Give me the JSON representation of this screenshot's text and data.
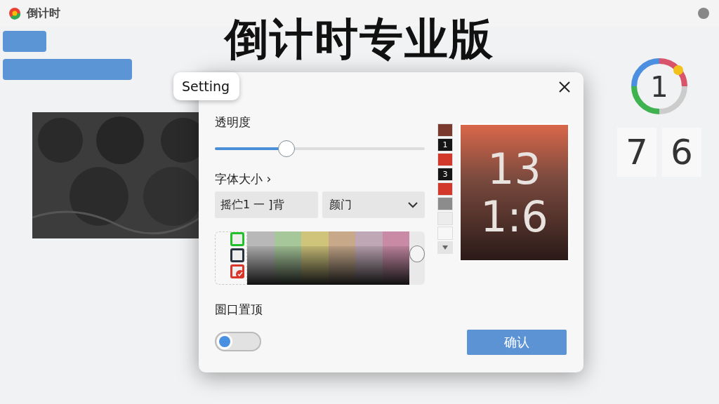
{
  "headline": "倒计时专业版",
  "window": {
    "title": "倒计时"
  },
  "background": {
    "ring_number": "1",
    "digits": [
      "7",
      "6"
    ]
  },
  "dialog": {
    "tab": "Setting",
    "opacity": {
      "label": "透明度",
      "level": 0.34
    },
    "font_size": {
      "label": "字体大小 ›",
      "field": "摇伫1 一 ]背",
      "dropdown": "颜门"
    },
    "swatches": [
      {
        "color": "#22c02a",
        "selected": false
      },
      {
        "color": "#2a3340",
        "selected": false
      },
      {
        "color": "#d9352a",
        "selected": true
      }
    ],
    "palette": [
      {
        "color": "#b8b8b8"
      },
      {
        "color": "#a6c79a"
      },
      {
        "color": "#cfc47a"
      },
      {
        "color": "#c7a98a"
      },
      {
        "color": "#bfa7b5"
      },
      {
        "color": "#c98aa6"
      }
    ],
    "pin": {
      "label": "圄口置顶",
      "on": false
    },
    "confirm": "确认",
    "thumbnails": [
      {
        "color": "#7a3a2e"
      },
      {
        "color": "#151515",
        "text": "1"
      },
      {
        "color": "#d3392a"
      },
      {
        "color": "#151515",
        "text": "3"
      },
      {
        "color": "#d3392a"
      },
      {
        "color": "#8c8c8c"
      },
      {
        "color": "#ececec"
      },
      {
        "color": "#f7f7f7"
      }
    ],
    "preview": {
      "lines": [
        "13",
        "1:6"
      ]
    }
  }
}
